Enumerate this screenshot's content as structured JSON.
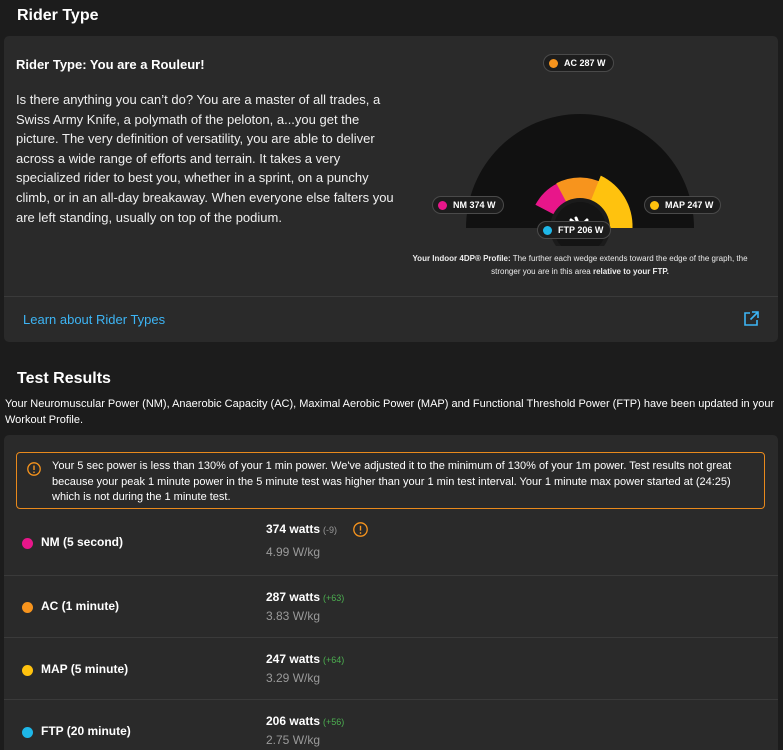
{
  "rider_section": {
    "title": "Rider Type",
    "heading": "Rider Type: You are a Rouleur!",
    "description": "Is there anything you can’t do? You are a master of all trades, a Swiss Army Knife, a polymath of the peloton, a...you get the picture. The very definition of versatility, you are able to deliver across a wide range of efforts and terrain. It takes a very specialized rider to best you, whether in a sprint, on a punchy climb, or in an all-day breakaway. When everyone else falters you are left standing, usually on top of the podium.",
    "learn_link": "Learn about Rider Types",
    "profile": {
      "labels": {
        "ac": "AC 287 W",
        "nm": "NM 374 W",
        "map": "MAP 247 W",
        "ftp": "FTP 206 W"
      },
      "caption_strong": "Your Indoor 4DP® Profile:",
      "caption_text": " The further each wedge extends toward the edge of the graph, the stronger you are in this area ",
      "caption_strong_end": "relative to your FTP.",
      "center_icon": "swiss-army-knife-icon"
    }
  },
  "test_section": {
    "title": "Test Results",
    "intro": "Your Neuromuscular Power (NM), Anaerobic Capacity (AC), Maximal Aerobic Power (MAP) and Functional Threshold Power (FTP) have been updated in your Workout Profile.",
    "warning": "Your 5 sec power is less than 130% of your 1 min power. We've adjusted it to the minimum of 130% of your 1m power. Test results not great because your peak 1 minute power in the 5 minute test was higher than your 1 min test interval. Your 1 minute max power started at (24:25) which is not during the 1 minute test.",
    "results": [
      {
        "label": "NM (5 second)",
        "watts": "374 watts",
        "delta": "(-9)",
        "wkg": "4.99 W/kg",
        "color": "#e8168a"
      },
      {
        "label": "AC (1 minute)",
        "watts": "287 watts",
        "delta": "(+63)",
        "wkg": "3.83 W/kg",
        "color": "#f7941d"
      },
      {
        "label": "MAP (5 minute)",
        "watts": "247 watts",
        "delta": "(+64)",
        "wkg": "3.29 W/kg",
        "color": "#ffc20e"
      },
      {
        "label": "FTP (20 minute)",
        "watts": "206 watts",
        "delta": "(+56)",
        "wkg": "2.75 W/kg",
        "color": "#1eb7e8"
      }
    ]
  },
  "colors": {
    "nm": "#e8168a",
    "ac": "#f7941d",
    "map": "#ffc20e",
    "ftp": "#1eb7e8",
    "link": "#3db5f5",
    "warning": "#e8891c"
  }
}
